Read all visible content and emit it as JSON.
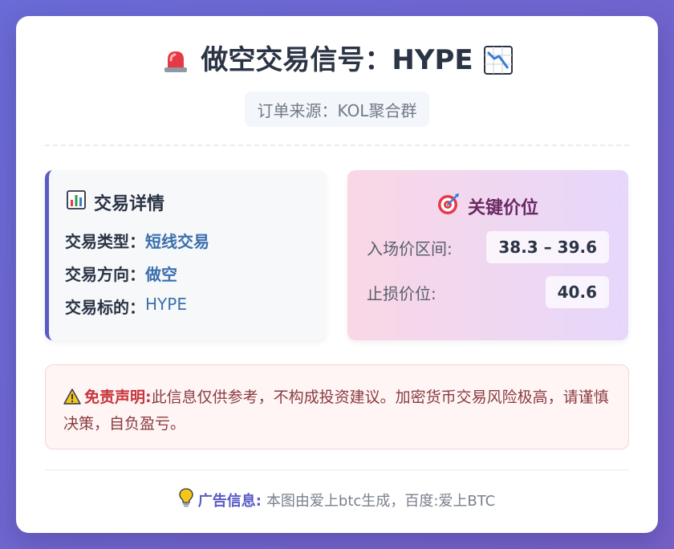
{
  "header": {
    "title": "做空交易信号：HYPE",
    "source": "订单来源：KOL聚合群"
  },
  "details": {
    "title": "交易详情",
    "rows": [
      {
        "label": "交易类型：",
        "value": "短线交易"
      },
      {
        "label": "交易方向：",
        "value": "做空"
      },
      {
        "label": "交易标的：",
        "value": "HYPE"
      }
    ]
  },
  "prices": {
    "title": "关键价位",
    "entry_label": "入场价区间:",
    "entry_value": "38.3 – 39.6",
    "stop_label": "止损价位:",
    "stop_value": "40.6"
  },
  "disclaimer": {
    "label": "免责声明:",
    "text": "此信息仅供参考，不构成投资建议。加密货币交易风险极高，请谨慎决策，自负盈亏。"
  },
  "footer": {
    "label": "广告信息:",
    "text": "本图由爱上btc生成，百度:爱上BTC"
  },
  "colors": {
    "accent": "#5a5bc6",
    "value_blue": "#3b6fad",
    "danger": "#c7333a"
  },
  "icons": [
    "siren-icon",
    "chart-down-icon",
    "bar-chart-icon",
    "target-icon",
    "warning-icon",
    "lightbulb-icon"
  ]
}
